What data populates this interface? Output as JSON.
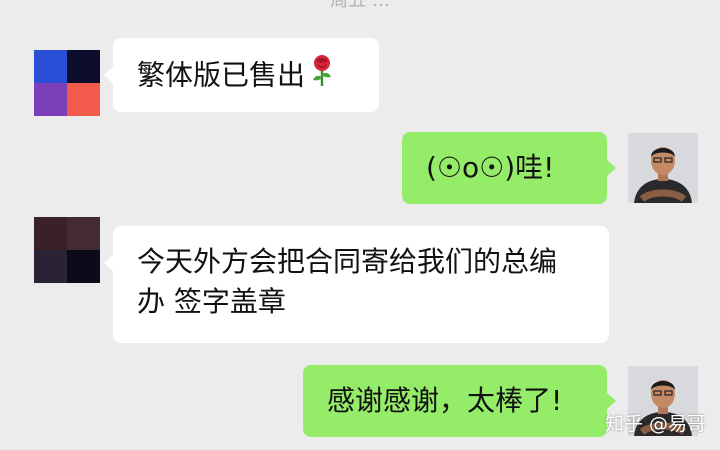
{
  "header": {
    "timestamp": "周五 …"
  },
  "messages": [
    {
      "text": "繁体版已售出",
      "emoji": "rose-icon"
    },
    {
      "text": "(☉o☉)哇!"
    },
    {
      "line1": "今天外方会把合同寄给我们的总编",
      "line2": "办 签字盖章"
    },
    {
      "text": "感谢感谢，太棒了!"
    }
  ],
  "watermark": "知乎 @易哥",
  "colors": {
    "background": "#ececec",
    "incoming_bubble": "#ffffff",
    "outgoing_bubble": "#95ec69",
    "avatar1": [
      "#2b4fd6",
      "#0e0d2c",
      "#7d3fb8",
      "#f25a4c"
    ],
    "avatar2": [
      "#3a2128",
      "#442a33",
      "#2b2236",
      "#0d0b1a"
    ]
  }
}
